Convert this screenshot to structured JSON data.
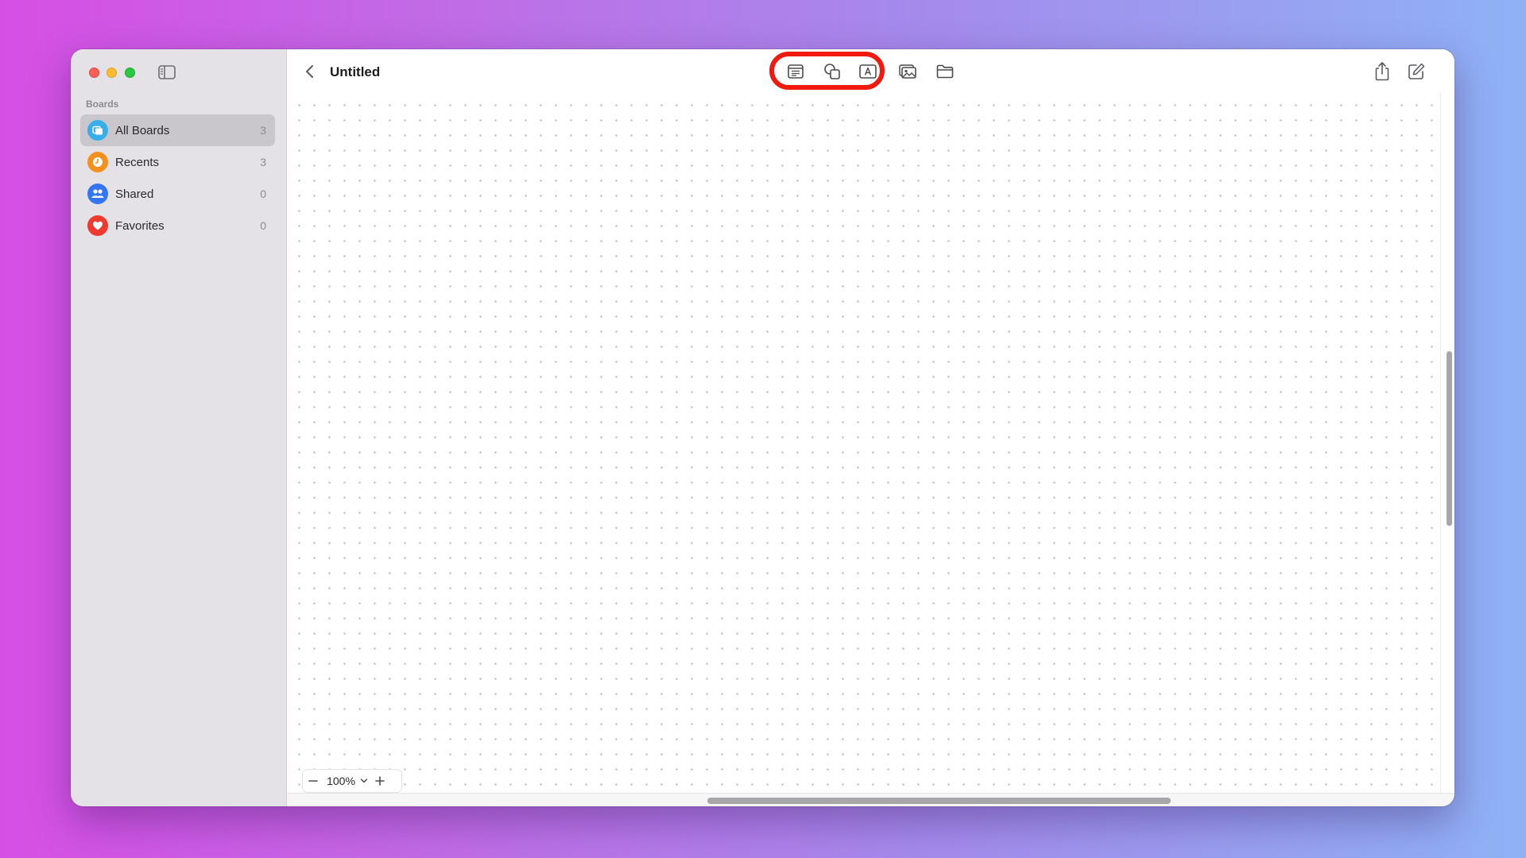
{
  "window": {
    "title": "Untitled"
  },
  "sidebar": {
    "section_label": "Boards",
    "items": [
      {
        "label": "All Boards",
        "count": "3",
        "icon": "boards-icon",
        "color": "#3aaee8",
        "selected": true
      },
      {
        "label": "Recents",
        "count": "3",
        "icon": "clock-icon",
        "color": "#f5901e",
        "selected": false
      },
      {
        "label": "Shared",
        "count": "0",
        "icon": "people-icon",
        "color": "#3476f1",
        "selected": false
      },
      {
        "label": "Favorites",
        "count": "0",
        "icon": "heart-icon",
        "color": "#ef3a2f",
        "selected": false
      }
    ]
  },
  "toolbar": {
    "tools": [
      {
        "name": "sticky-note-icon"
      },
      {
        "name": "shapes-icon"
      },
      {
        "name": "text-box-icon"
      },
      {
        "name": "media-icon"
      },
      {
        "name": "folder-icon"
      }
    ],
    "highlight_color": "#f11a0e"
  },
  "zoom": {
    "value": "100%",
    "minus": "−",
    "plus": "+"
  },
  "colors": {
    "accent_red": "#f11a0e",
    "sidebar_bg": "#e4e1e7",
    "selected_row": "#cac7cc"
  }
}
